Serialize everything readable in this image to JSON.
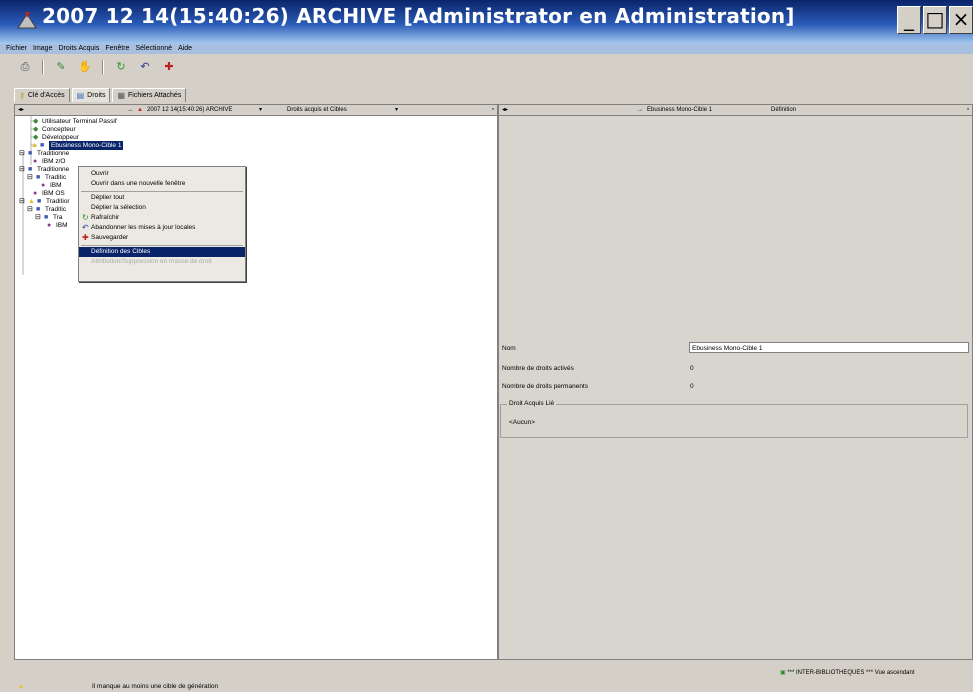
{
  "window": {
    "title": "2007 12 14(15:40:26) ARCHIVE [Administrator en Administration]",
    "controls": [
      "_",
      "□",
      "×"
    ]
  },
  "menubar": [
    "Fichier",
    "Image",
    "Droits Acquis",
    "Fenêtre",
    "Sélectionné",
    "Aide"
  ],
  "tabs": [
    {
      "label": "Clé d'Accès",
      "icon": "key-icon"
    },
    {
      "label": "Droits",
      "icon": "rights-icon"
    },
    {
      "label": "Fichiers Attachés",
      "icon": "document-icon"
    }
  ],
  "left_header": {
    "archive": "2007 12 14(15:40:26) ARCHIVE",
    "dropdown": "Droits acquis et Cibles"
  },
  "tree": [
    {
      "label": "Utilisateur Terminal Passif"
    },
    {
      "label": "Concepteur"
    },
    {
      "label": "Développeur"
    },
    {
      "label": "Ebusiness Mono-Cible 1",
      "selected": true
    },
    {
      "label": "Traditionne"
    },
    {
      "label": "IBM z/O"
    },
    {
      "label": "Traditionne"
    },
    {
      "label": "Traditic"
    },
    {
      "label": "IBM"
    },
    {
      "label": "IBM OS"
    },
    {
      "label": "Traditior"
    },
    {
      "label": "Traditic"
    },
    {
      "label": "Tra"
    },
    {
      "label": "IBM"
    }
  ],
  "context_menu": [
    {
      "label": "Ouvrir"
    },
    {
      "label": "Ouvrir dans une nouvelle fenêtre"
    },
    {
      "label": "Déplier tout"
    },
    {
      "label": "Déplier la sélection"
    },
    {
      "label": "Rafraîchir",
      "icon": "refresh-icon"
    },
    {
      "label": "Abandonner les mises à jour locales",
      "icon": "undo-icon"
    },
    {
      "label": "Sauvegarder",
      "icon": "save-icon"
    },
    {
      "label": "Définition des Cibles",
      "highlighted": true
    },
    {
      "label": "Attribution/Suppression en masse de droit",
      "disabled": true
    }
  ],
  "right_header": {
    "target": "Ebusiness Mono-Cible 1",
    "tab": "Définition"
  },
  "form": {
    "nom_label": "Nom",
    "nom_value": "Ebusiness Mono-Cible 1",
    "droits_actives_label": "Nombre de droits activés",
    "droits_actives_value": "0",
    "droits_permanents_label": "Nombre de droits permanents",
    "droits_permanents_value": "0",
    "group_title": "Droit Acquis Lié",
    "group_value": "<Aucun>"
  },
  "statusbar": {
    "right": "*** INTER-BIBLIOTHEQUES *** Vue ascendant",
    "bottom": "Il manque au moins une cible de génération"
  },
  "colors": {
    "title_bar": "#0a246a",
    "selection": "#0a246a",
    "background": "#d4d0c8"
  }
}
